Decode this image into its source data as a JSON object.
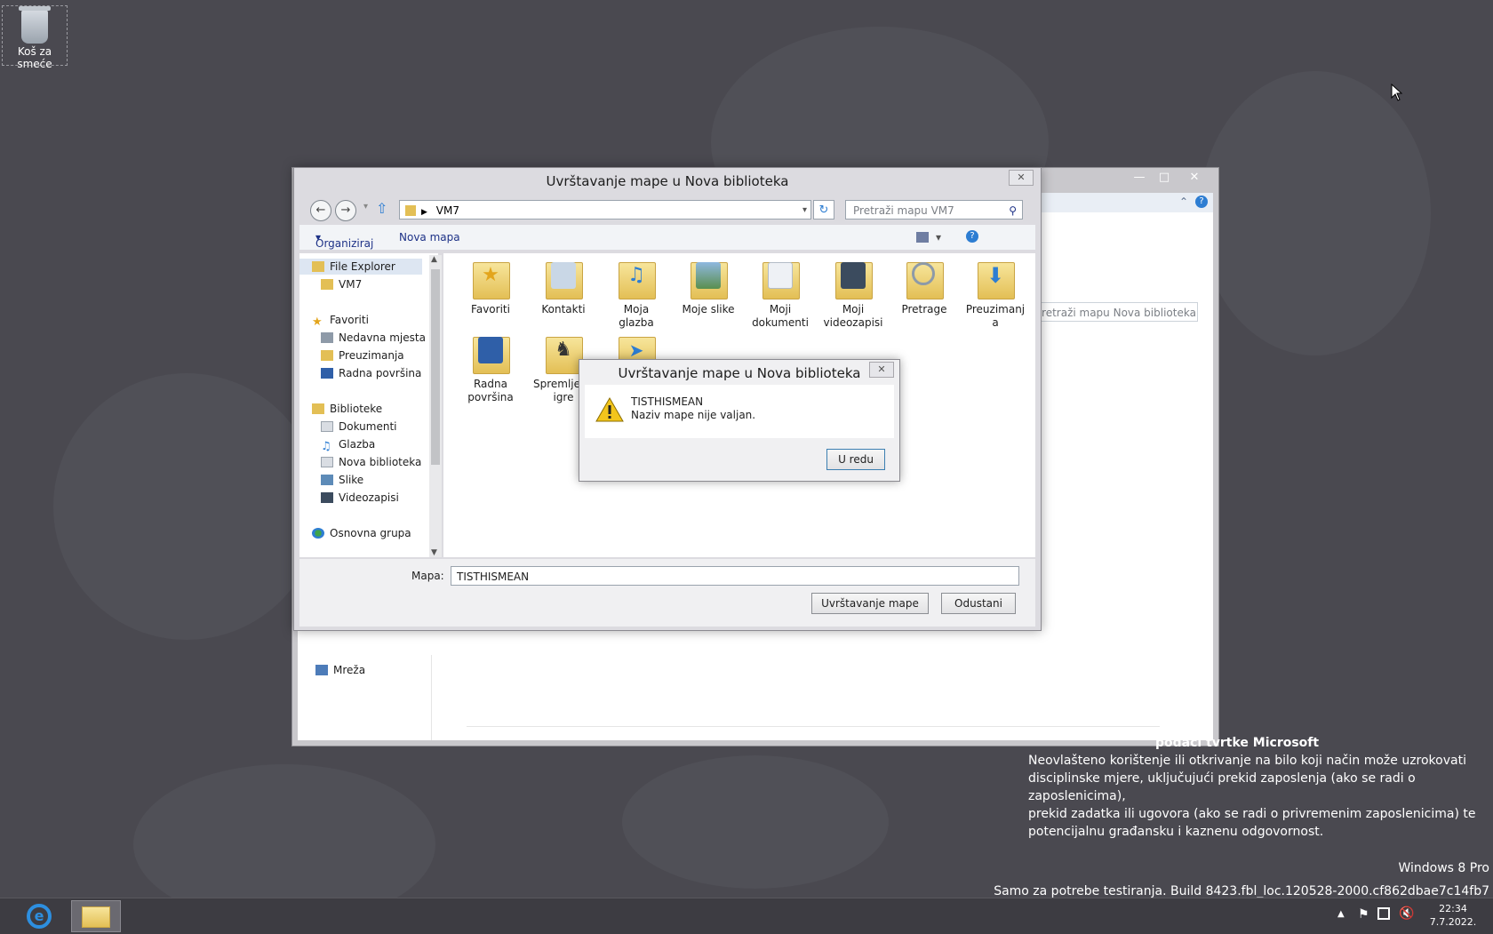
{
  "desktop": {
    "recycle_bin_label": "Koš za smeće"
  },
  "background_window": {
    "search_placeholder": "Pretraži mapu Nova biblioteka",
    "network_label": "Mreža"
  },
  "dialog": {
    "title": "Uvrštavanje mape u Nova biblioteka",
    "address_path": "VM7",
    "search_placeholder": "Pretraži mapu VM7",
    "toolbar": {
      "organize_label": "Organiziraj",
      "new_folder_label": "Nova mapa"
    },
    "nav": {
      "file_explorer": "File Explorer",
      "vm7": "VM7",
      "favorites": "Favoriti",
      "recent": "Nedavna mjesta",
      "downloads": "Preuzimanja",
      "desktop": "Radna površina",
      "libraries": "Biblioteke",
      "documents": "Dokumenti",
      "music": "Glazba",
      "new_library": "Nova biblioteka",
      "pictures": "Slike",
      "videos": "Videozapisi",
      "homegroup": "Osnovna grupa"
    },
    "folders": [
      {
        "line1": "Favoriti",
        "line2": ""
      },
      {
        "line1": "Kontakti",
        "line2": ""
      },
      {
        "line1": "Moja",
        "line2": "glazba"
      },
      {
        "line1": "Moje slike",
        "line2": ""
      },
      {
        "line1": "Moji",
        "line2": "dokumenti"
      },
      {
        "line1": "Moji",
        "line2": "videozapisi"
      },
      {
        "line1": "Pretrage",
        "line2": ""
      },
      {
        "line1": "Preuzimanj",
        "line2": "a"
      },
      {
        "line1": "Radna",
        "line2": "površina"
      },
      {
        "line1": "Spremljene",
        "line2": "igre"
      },
      {
        "line1": "",
        "line2": ""
      }
    ],
    "folder_label": "Mapa:",
    "folder_value": "TISTHISMEAN",
    "include_button": "Uvrštavanje mape",
    "cancel_button": "Odustani"
  },
  "message_box": {
    "title": "Uvrštavanje mape u Nova biblioteka",
    "line1": "TISTHISMEAN",
    "line2": "Naziv mape nije valjan.",
    "ok_button": "U redu"
  },
  "watermark": {
    "heading": "podaci tvrtke Microsoft",
    "line1": "Neovlašteno korištenje ili otkrivanje na bilo koji način može uzrokovati",
    "line2": "disciplinske mjere, uključujući prekid zaposlenja (ako se radi o zaposlenicima),",
    "line3": "prekid zadatka ili ugovora (ako se radi o privremenim zaposlenicima) te",
    "line4": "potencijalnu građansku i kaznenu odgovornost.",
    "edition": "Windows 8 Pro",
    "build": "Samo za potrebe testiranja. Build 8423.fbl_loc.120528-2000.cf862dbae7c14fb7"
  },
  "taskbar": {
    "time": "22:34",
    "date": "7.7.2022."
  },
  "colors": {
    "desktop_bg": "#4a4950",
    "taskbar_bg": "#3d3c42",
    "link_blue": "#1e3287"
  }
}
